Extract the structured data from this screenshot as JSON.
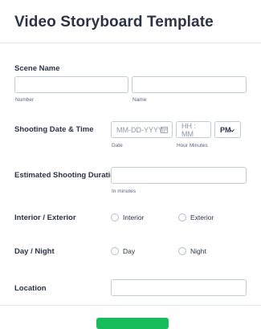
{
  "form": {
    "title": "Video Storyboard Template",
    "scene": {
      "label": "Scene Name",
      "number_sublabel": "Number",
      "name_sublabel": "Name",
      "number_value": "",
      "name_value": ""
    },
    "shooting": {
      "label": "Shooting Date & Time",
      "date_placeholder": "MM-DD-YYYY",
      "date_sublabel": "Date",
      "time_placeholder": "HH : MM",
      "time_sublabel": "Hour Minutes",
      "ampm_value": "PM",
      "calendar_icon": "calendar-icon",
      "dropdown_icon": "chevron-down-icon"
    },
    "duration": {
      "label": "Estimated Shooting Duration",
      "sublabel": "In minutes",
      "value": ""
    },
    "interior_exterior": {
      "label": "Interior / Exterior",
      "options": [
        "Interior",
        "Exterior"
      ]
    },
    "day_night": {
      "label": "Day / Night",
      "options": [
        "Day",
        "Night"
      ]
    },
    "location": {
      "label": "Location",
      "value": ""
    },
    "submit_color": "#18bd5b"
  }
}
